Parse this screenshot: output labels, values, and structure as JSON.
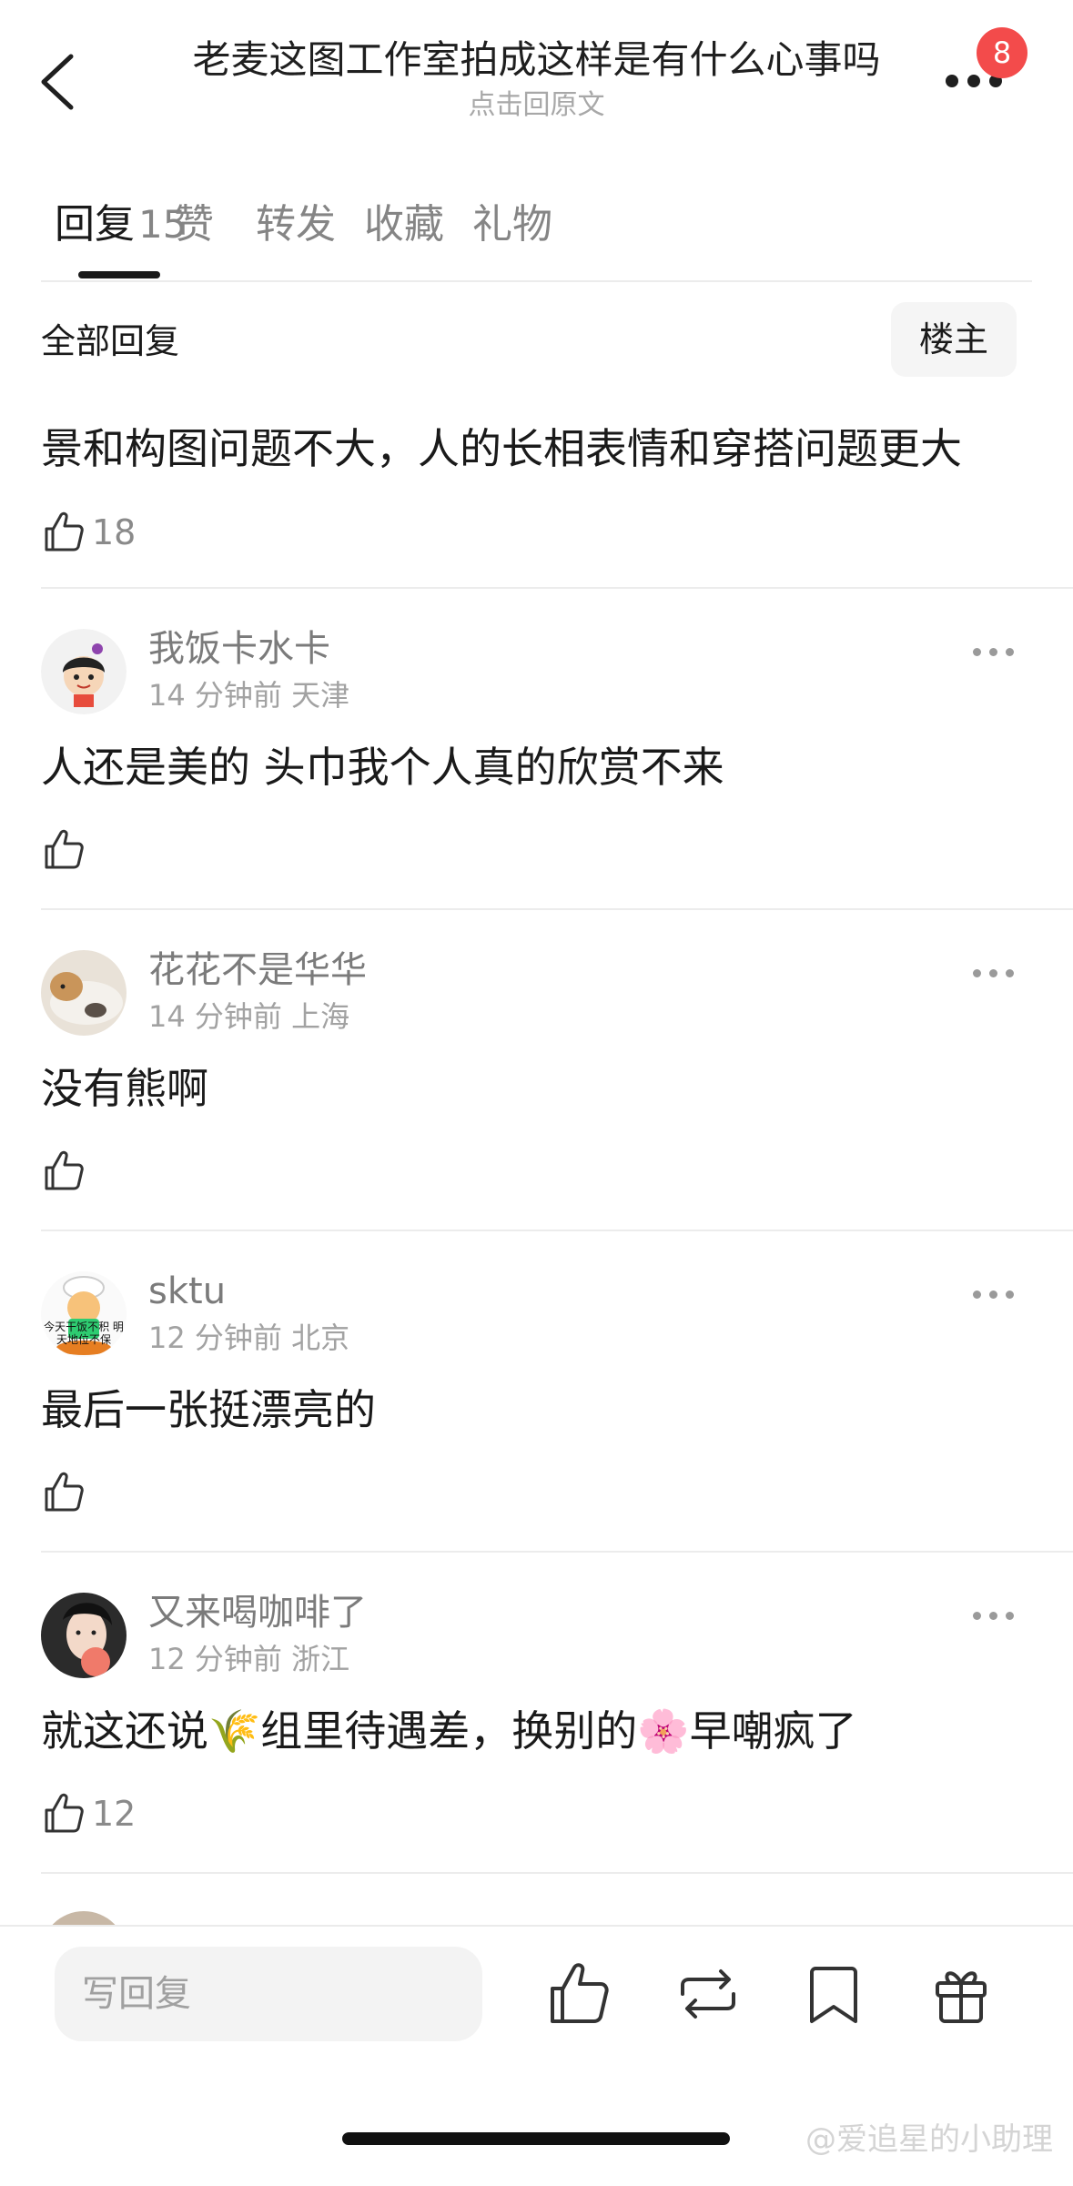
{
  "header": {
    "title": "老麦这图工作室拍成这样是有什么心事吗",
    "subtitle": "点击回原文",
    "notification_count": "8"
  },
  "tabs": [
    {
      "label": "回复",
      "count": "15",
      "active": true
    },
    {
      "label": "赞"
    },
    {
      "label": "转发"
    },
    {
      "label": "收藏"
    },
    {
      "label": "礼物"
    }
  ],
  "section": {
    "title": "全部回复",
    "filter_button": "楼主"
  },
  "main_comment": {
    "text": "景和构图问题不大，人的长相表情和穿搭问题更大",
    "likes": "18"
  },
  "comments": [
    {
      "username": "我饭卡水卡",
      "time": "14 分钟前",
      "location": "天津",
      "text": "人还是美的 头巾我个人真的欣赏不来",
      "likes": ""
    },
    {
      "username": "花花不是华华",
      "time": "14 分钟前",
      "location": "上海",
      "text": "没有熊啊",
      "likes": ""
    },
    {
      "username": "sktu",
      "time": "12 分钟前",
      "location": "北京",
      "text": "最后一张挺漂亮的",
      "likes": "",
      "avatar_text": "今天干饭不积 明天地位不保"
    },
    {
      "username": "又来喝咖啡了",
      "time": "12 分钟前",
      "location": "浙江",
      "text_before": "就这还说",
      "text_middle": "组里待遇差，换别的",
      "text_after": "早嘲疯了",
      "emoji_1": "🌾",
      "emoji_2": "🌸",
      "likes": "12"
    }
  ],
  "bottom_bar": {
    "reply_placeholder": "写回复",
    "icons": [
      "like-icon",
      "repost-icon",
      "bookmark-icon",
      "gift-icon"
    ]
  },
  "watermark": "@爱追星的小助理"
}
